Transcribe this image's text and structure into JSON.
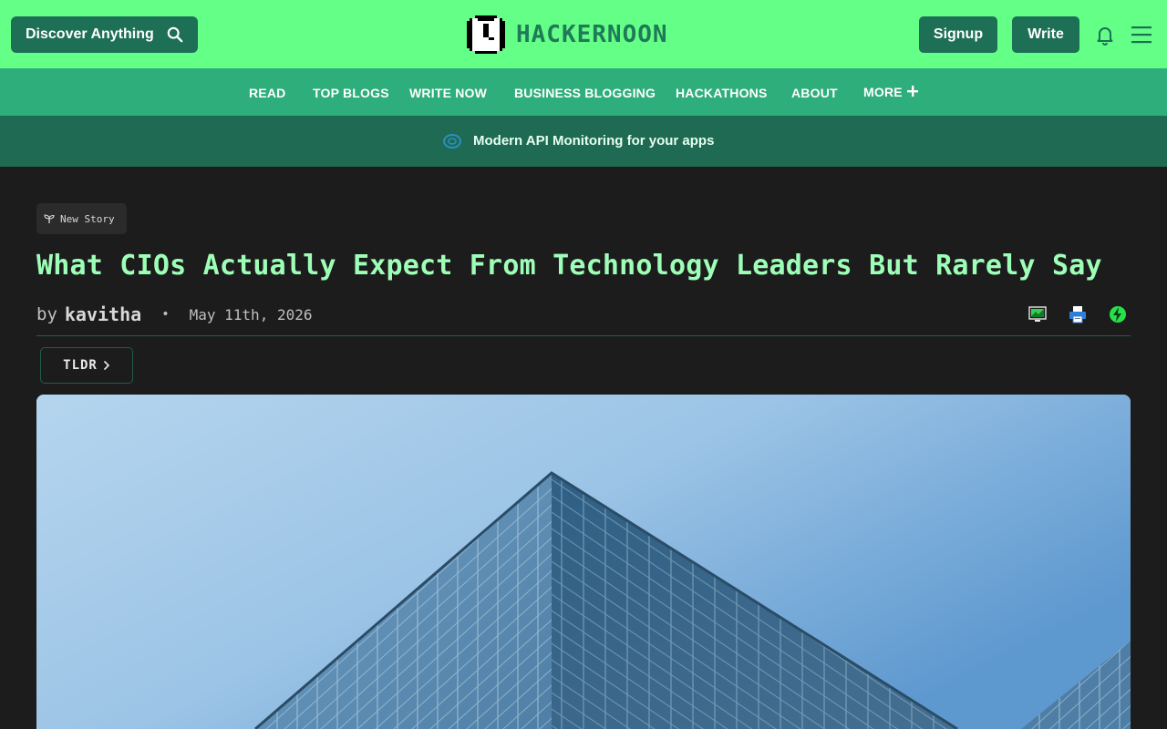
{
  "header": {
    "search_label": "Discover Anything",
    "logo_text": "HACKERNOON",
    "signup_label": "Signup",
    "write_label": "Write"
  },
  "nav": {
    "items": [
      "READ",
      "TOP BLOGS",
      "WRITE NOW",
      "BUSINESS BLOGGING",
      "HACKATHONS",
      "ABOUT",
      "MORE"
    ]
  },
  "banner": {
    "text": "Modern API Monitoring for your apps"
  },
  "story": {
    "badge": "New Story",
    "title": "What CIOs Actually Expect From Technology Leaders But Rarely Say",
    "by": "by",
    "author": "kavitha",
    "date": "May 11th, 2026",
    "tldr_label": "TLDR"
  },
  "colors": {
    "top_bar": "#64ff86",
    "nav_bar": "#2eae7a",
    "banner": "#1e6a52",
    "button": "#1d6f55",
    "title_text": "#9dffb7",
    "page_bg": "#1c1c1c"
  }
}
